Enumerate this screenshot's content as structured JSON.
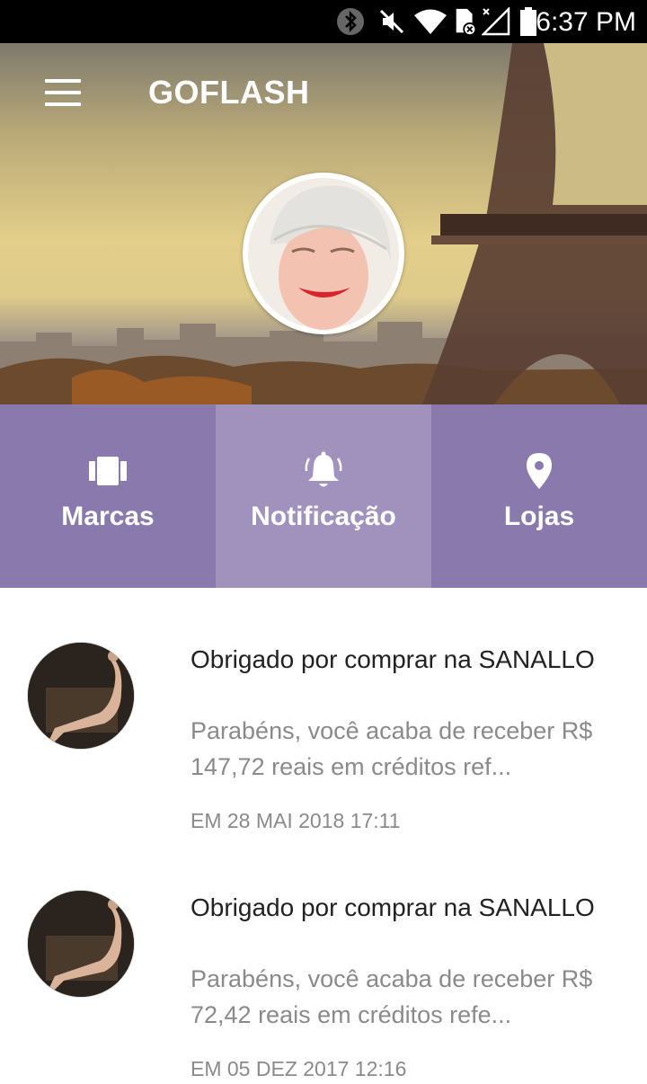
{
  "status_bar": {
    "time": "6:37 PM",
    "icons": [
      "bluetooth-icon",
      "mute-icon",
      "wifi-icon",
      "sim-icon",
      "signal-icon",
      "battery-icon"
    ]
  },
  "header": {
    "title": "GOFLASH",
    "menu_icon": "hamburger-menu-icon"
  },
  "tabs": [
    {
      "label": "Marcas",
      "icon": "brands-icon",
      "active": false
    },
    {
      "label": "Notificação",
      "icon": "bell-icon",
      "active": true
    },
    {
      "label": "Lojas",
      "icon": "location-pin-icon",
      "active": false
    }
  ],
  "notifications": [
    {
      "title": "Obrigado por comprar na SANALLO",
      "body": "Parabéns, você acaba de receber R$ 147,72 reais em créditos ref...",
      "date": "EM 28 MAI 2018 17:11"
    },
    {
      "title": "Obrigado por comprar na SANALLO",
      "body": "Parabéns, você acaba de receber R$ 72,42 reais em créditos refe...",
      "date": "EM 05 DEZ 2017 12:16"
    }
  ],
  "colors": {
    "tab_bg": "#8a79ad",
    "tab_active_bg": "#a092bd",
    "status_bar": "#000000"
  }
}
